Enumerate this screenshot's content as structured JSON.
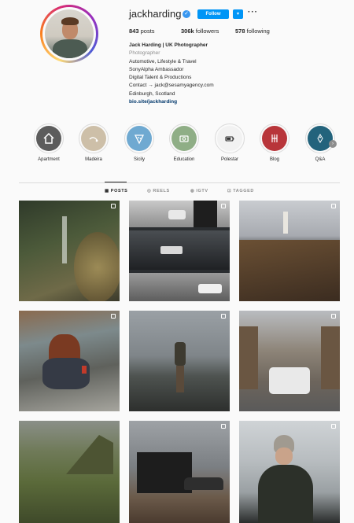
{
  "profile": {
    "username": "jackharding",
    "verified_icon": "verified-badge-icon",
    "follow_label": "Follow",
    "dropdown_icon": "chevron-down-icon",
    "more_icon": "more-horizontal-icon",
    "stats": {
      "posts_count": "843",
      "posts_label": "posts",
      "followers_count": "306k",
      "followers_label": "followers",
      "following_count": "578",
      "following_label": "following"
    },
    "bio": {
      "name": "Jack Harding | UK Photographer",
      "category": "Photographer",
      "line1": "Automotive, Lifestyle & Travel",
      "line2": "SonyAlpha Ambassador",
      "line3": "Digital Talent & Productions",
      "line4": "Contact → jack@sesamyagency.com",
      "line5": "Edinburgh, Scotland",
      "link": "bio.site/jackharding"
    }
  },
  "highlights": [
    {
      "label": "Apartment",
      "icon": "house-icon",
      "color": "#5c5c5c"
    },
    {
      "label": "Madeira",
      "icon": "road-icon",
      "color": "#cdbfa8"
    },
    {
      "label": "Sicily",
      "icon": "pizza-icon",
      "color": "#6fa9d1"
    },
    {
      "label": "Education",
      "icon": "camera-icon",
      "color": "#8fae86"
    },
    {
      "label": "Polestar",
      "icon": "battery-icon",
      "color": "#f2f2f2"
    },
    {
      "label": "Blog",
      "icon": "blog-icon",
      "color": "#b8353a"
    },
    {
      "label": "Q&A",
      "icon": "question-icon",
      "color": "#23637c"
    }
  ],
  "tabs": [
    {
      "label": "POSTS",
      "icon": "grid-icon"
    },
    {
      "label": "REELS",
      "icon": "reels-icon"
    },
    {
      "label": "IGTV",
      "icon": "igtv-icon"
    },
    {
      "label": "TAGGED",
      "icon": "tag-icon"
    }
  ]
}
